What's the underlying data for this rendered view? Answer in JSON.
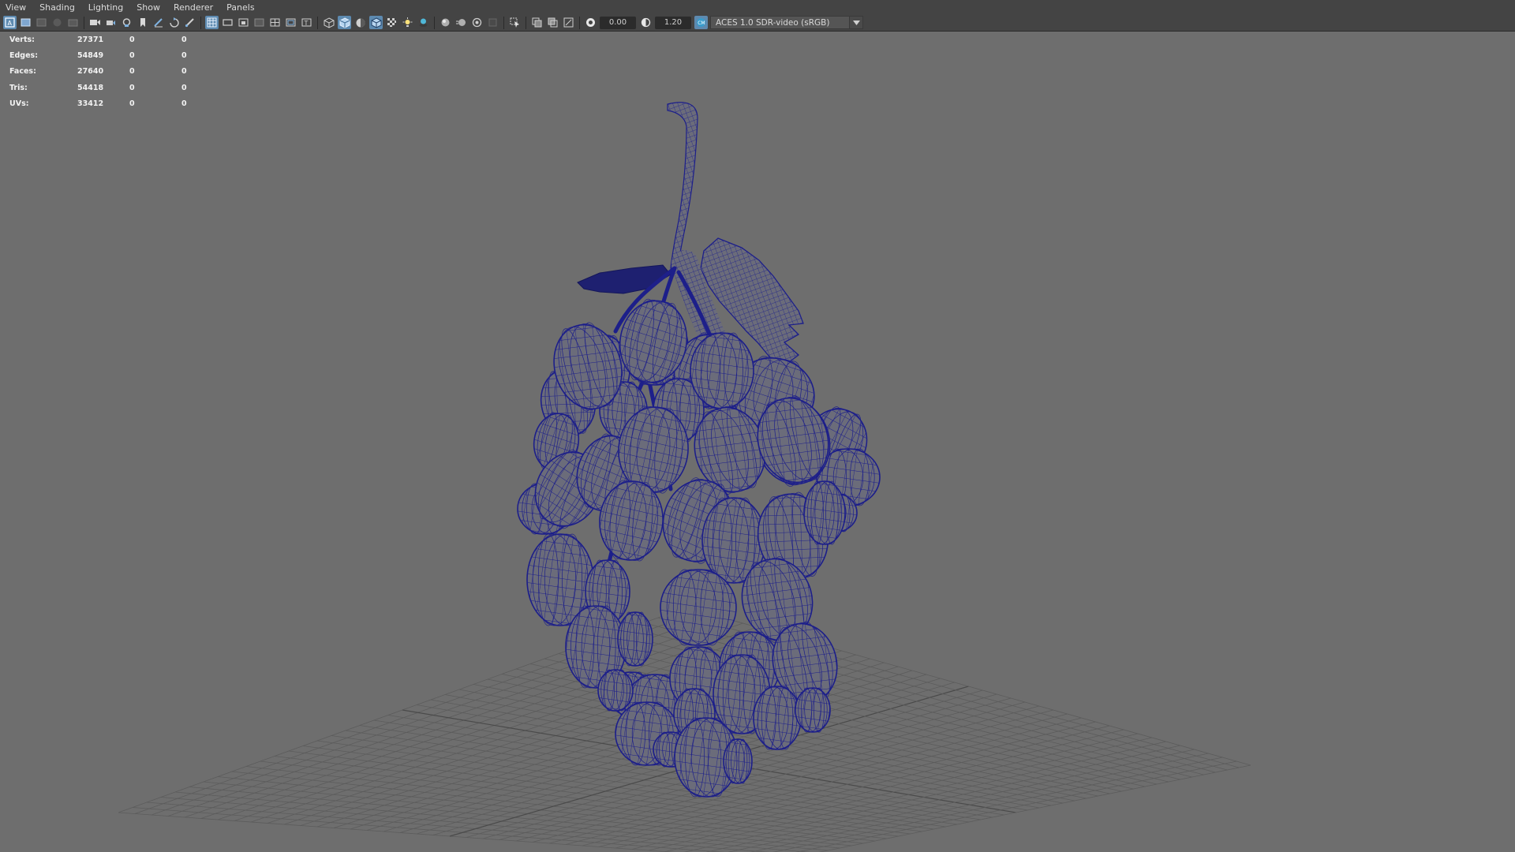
{
  "menu": {
    "items": [
      "View",
      "Shading",
      "Lighting",
      "Show",
      "Renderer",
      "Panels"
    ]
  },
  "toolbar": {
    "exposure_value": "0.00",
    "gamma_value": "1.20",
    "color_management_label": "ACES 1.0 SDR-video (sRGB)"
  },
  "hud": {
    "rows": [
      {
        "label": "Verts:",
        "value": "27371",
        "selected": "0",
        "uv_selected": "0"
      },
      {
        "label": "Edges:",
        "value": "54849",
        "selected": "0",
        "uv_selected": "0"
      },
      {
        "label": "Faces:",
        "value": "27640",
        "selected": "0",
        "uv_selected": "0"
      },
      {
        "label": "Tris:",
        "value": "54418",
        "selected": "0",
        "uv_selected": "0"
      },
      {
        "label": "UVs:",
        "value": "33412",
        "selected": "0",
        "uv_selected": "0"
      }
    ]
  },
  "colors": {
    "viewport_bg": "#6e6e6e",
    "wireframe": "#1d1f8a",
    "grape_fill": "#6b6c7a",
    "grid_line": "#5a5a5a",
    "active_button": "#5d8ab0"
  }
}
